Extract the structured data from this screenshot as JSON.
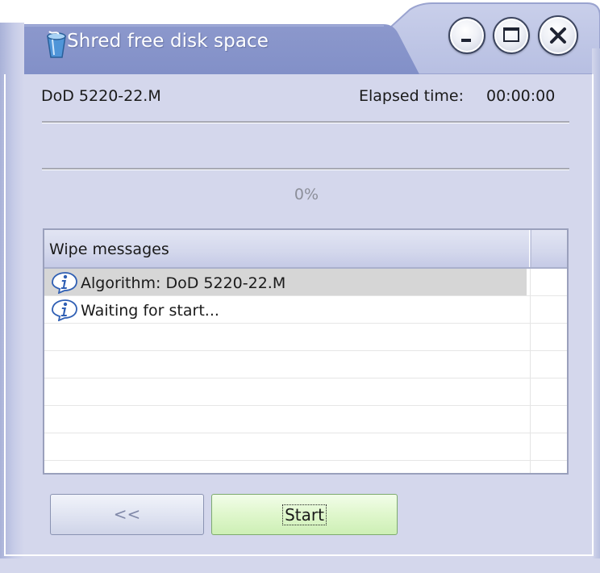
{
  "window": {
    "title": "Shred free disk space",
    "icons": {
      "app": "shredder-bin-icon",
      "minimize": "minimize-icon",
      "maximize": "maximize-icon",
      "close": "close-icon"
    }
  },
  "info": {
    "algorithm": "DoD 5220-22.M",
    "elapsed_label": "Elapsed time:",
    "elapsed_value": "00:00:00"
  },
  "progress": {
    "value": 0,
    "text": "0%"
  },
  "messages": {
    "header": "Wipe messages",
    "rows": [
      {
        "icon": "info-icon",
        "text": "Algorithm: DoD 5220-22.M",
        "selected": true
      },
      {
        "icon": "info-icon",
        "text": "Waiting for start...",
        "selected": false
      },
      {
        "icon": "",
        "text": "",
        "selected": false
      },
      {
        "icon": "",
        "text": "",
        "selected": false
      },
      {
        "icon": "",
        "text": "",
        "selected": false
      },
      {
        "icon": "",
        "text": "",
        "selected": false
      },
      {
        "icon": "",
        "text": "",
        "selected": false
      }
    ]
  },
  "buttons": {
    "back": "<<",
    "start": "Start"
  },
  "colors": {
    "frame": "#a9b2d8",
    "client_bg": "#d4d7ec",
    "start_button": "#dff7cc",
    "selected_row": "#d6d6d6"
  }
}
